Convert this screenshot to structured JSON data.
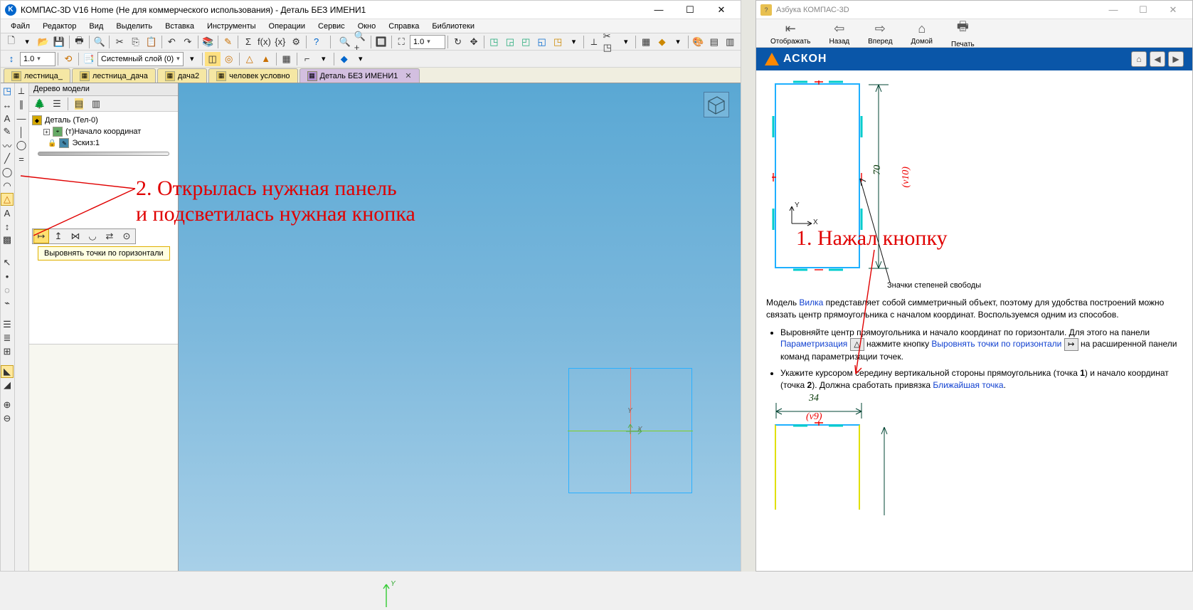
{
  "mainWindow": {
    "title": "КОМПАС-3D V16 Home  (Не для коммерческого использования) - Деталь БЕЗ ИМЕНИ1",
    "iconLetter": "K"
  },
  "menu": [
    "Файл",
    "Редактор",
    "Вид",
    "Выделить",
    "Вставка",
    "Инструменты",
    "Операции",
    "Сервис",
    "Окно",
    "Справка",
    "Библиотеки"
  ],
  "toolbar2": {
    "combo1": "1.0",
    "layerCombo": "Системный слой (0)",
    "zoomCombo": "1.0"
  },
  "tabs": [
    {
      "label": "лестница_",
      "active": false
    },
    {
      "label": "лестница_дача",
      "active": false
    },
    {
      "label": "дача2",
      "active": false
    },
    {
      "label": "человек условно",
      "active": false
    },
    {
      "label": "Деталь БЕЗ ИМЕНИ1",
      "active": true
    }
  ],
  "treePanel": {
    "header": "Дерево модели",
    "rootItem": "Деталь (Тел-0)",
    "item1": "(т)Начало координат",
    "item2": "Эскиз:1"
  },
  "tooltip": "Выровнять точки по горизонтали",
  "annotation2": "2. Открылась нужная панель\nи подсветилась нужная кнопка",
  "annotation1": "1. Нажал кнопку",
  "canvas": {
    "axisX": "X",
    "axisY": "Y"
  },
  "helpWindow": {
    "title": "Азбука КОМПАС-3D",
    "tbButtons": [
      "Отображать",
      "Назад",
      "Вперед",
      "Домой",
      "Печать"
    ],
    "brand": "АСКОН",
    "figCaption": "Значки степеней свободы",
    "dim70": "70",
    "dimV10": "(v10)",
    "dim34": "34",
    "dimV9": "(v9)",
    "paragraph1_pre": "Модель ",
    "paragraph1_link": "Вилка",
    "paragraph1_post": " представляет собой симметричный объект, поэтому для удобства построений можно связать центр прямоугольника с началом координат. Воспользуемся одним из способов.",
    "li1_pre": "Выровняйте центр прямоугольника и начало координат по горизонтали. Для этого на панели ",
    "li1_link1": "Параметризация",
    "li1_mid": " нажмите кнопку ",
    "li1_link2": "Выровнять точки по горизонтали",
    "li1_post": " на расширенной панели команд параметризации точек.",
    "li2_pre": "Укажите курсором середину вертикальной стороны прямоугольника (точка ",
    "li2_b1": "1",
    "li2_mid": ") и начало координат (точка ",
    "li2_b2": "2",
    "li2_mid2": "). Должна сработать привязка ",
    "li2_link": "Ближайшая точка",
    "li2_post": "."
  }
}
